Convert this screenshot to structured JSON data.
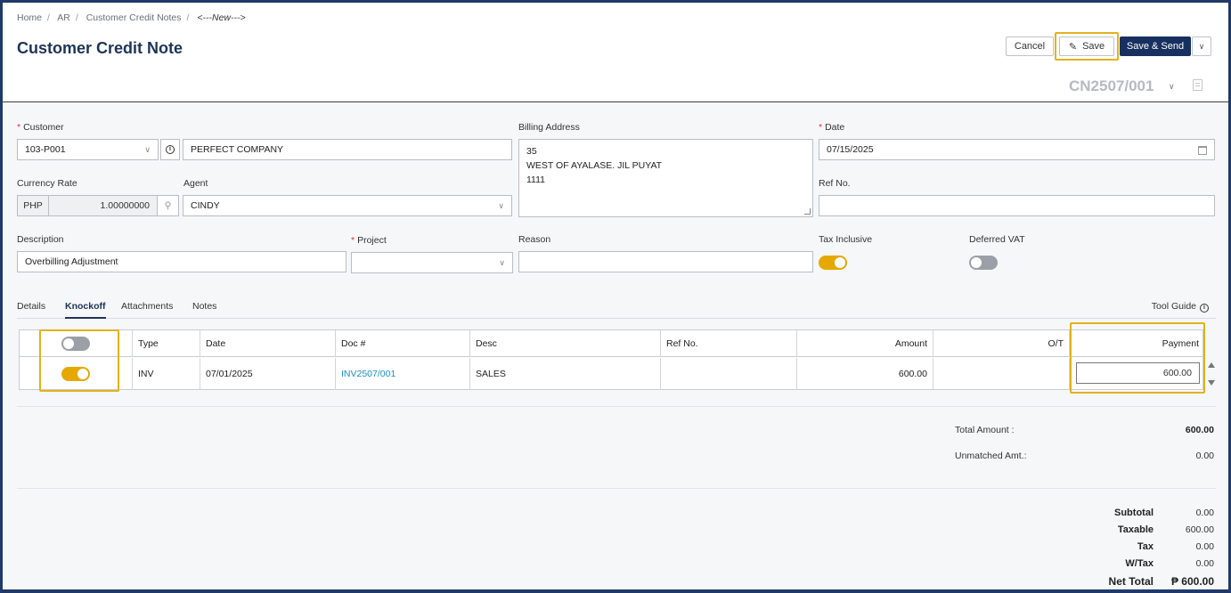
{
  "breadcrumb": {
    "items": [
      "Home",
      "AR",
      "Customer Credit Notes"
    ],
    "current": "<---New--->"
  },
  "page": {
    "title": "Customer Credit Note"
  },
  "toolbar": {
    "cancel": "Cancel",
    "save": "Save",
    "save_send": "Save & Send",
    "more_icon": "chevron-down-icon"
  },
  "document": {
    "number": "CN2507/001"
  },
  "form": {
    "customer": {
      "label": "Customer",
      "code": "103-P001",
      "name": "PERFECT COMPANY"
    },
    "billing": {
      "label": "Billing Address",
      "lines": [
        "35",
        "WEST OF AYALASE. JIL PUYAT",
        "1111"
      ]
    },
    "date": {
      "label": "Date",
      "value": "07/15/2025"
    },
    "currency": {
      "label": "Currency Rate",
      "code": "PHP",
      "rate": "1.00000000"
    },
    "agent": {
      "label": "Agent",
      "value": "CINDY"
    },
    "ref_no": {
      "label": "Ref No.",
      "value": ""
    },
    "description": {
      "label": "Description",
      "value": "Overbilling Adjustment"
    },
    "project": {
      "label": "Project",
      "value": ""
    },
    "reason": {
      "label": "Reason",
      "value": ""
    },
    "tax_inclusive": {
      "label": "Tax Inclusive",
      "on": true
    },
    "deferred_vat": {
      "label": "Deferred VAT",
      "on": false
    }
  },
  "tabs": [
    "Details",
    "Knockoff",
    "Attachments",
    "Notes"
  ],
  "active_tab": "Knockoff",
  "tool_guide": "Tool Guide",
  "table": {
    "headers": [
      "Type",
      "Date",
      "Doc #",
      "Desc",
      "Ref No.",
      "Amount",
      "O/T",
      "Payment"
    ],
    "rows": [
      {
        "selected": true,
        "type": "INV",
        "date": "07/01/2025",
        "doc": "INV2507/001",
        "desc": "SALES",
        "ref": "",
        "amount": "600.00",
        "ot": "",
        "payment": "600.00"
      }
    ]
  },
  "totals": {
    "total_amount": {
      "label": "Total Amount :",
      "value": "600.00"
    },
    "unmatched": {
      "label": "Unmatched Amt.:",
      "value": "0.00"
    }
  },
  "summary": [
    {
      "label": "Subtotal",
      "value": "0.00"
    },
    {
      "label": "Taxable",
      "value": "600.00"
    },
    {
      "label": "Tax",
      "value": "0.00"
    },
    {
      "label": "W/Tax",
      "value": "0.00"
    },
    {
      "label": "Net Total",
      "value": "₱ 600.00"
    }
  ],
  "colors": {
    "primary": "#18305f",
    "accent": "#e5a800",
    "highlight": "#e3b21c",
    "link": "#1a8fc9"
  }
}
